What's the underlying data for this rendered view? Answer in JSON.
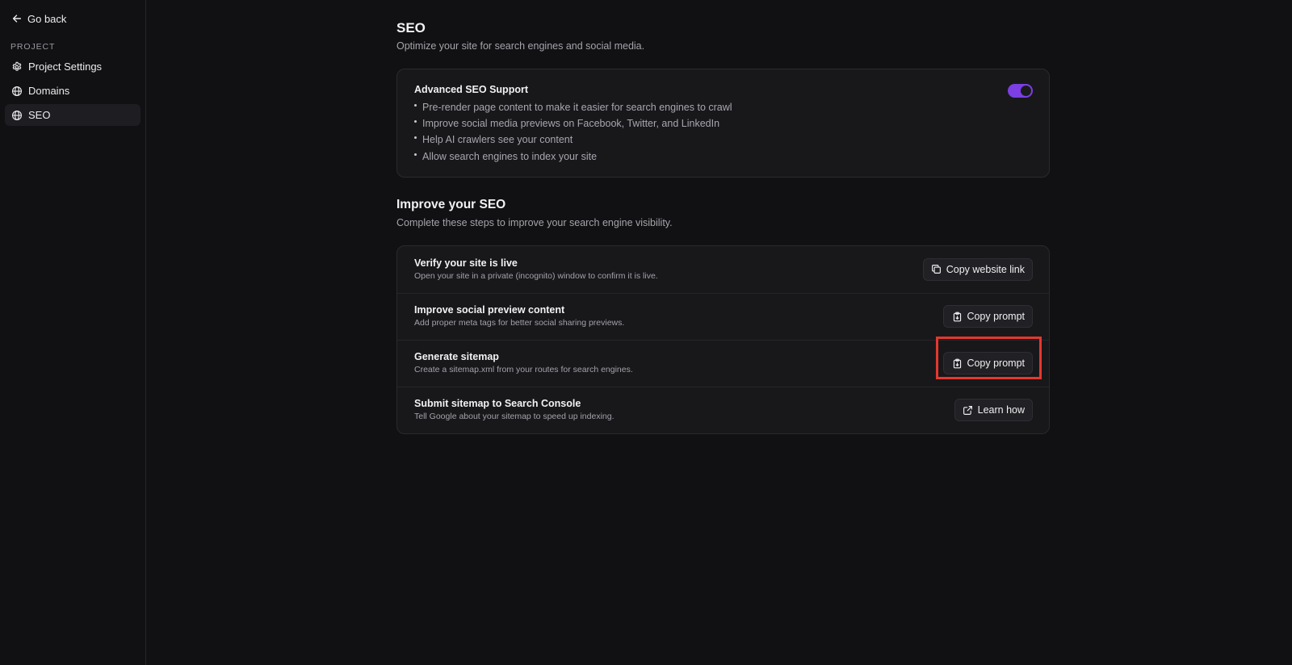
{
  "sidebar": {
    "go_back": "Go back",
    "section_label": "PROJECT",
    "items": [
      {
        "label": "Project Settings",
        "icon": "gear-icon"
      },
      {
        "label": "Domains",
        "icon": "globe-icon"
      },
      {
        "label": "SEO",
        "icon": "globe-icon",
        "active": true
      }
    ]
  },
  "header": {
    "title": "SEO",
    "subtitle": "Optimize your site for search engines and social media."
  },
  "advanced_seo": {
    "title": "Advanced SEO Support",
    "enabled": true,
    "bullets": [
      "Pre-render page content to make it easier for search engines to crawl",
      "Improve social media previews on Facebook, Twitter, and LinkedIn",
      "Help AI crawlers see your content",
      "Allow search engines to index your site"
    ]
  },
  "improve": {
    "title": "Improve your SEO",
    "subtitle": "Complete these steps to improve your search engine visibility.",
    "steps": [
      {
        "title": "Verify your site is live",
        "description": "Open your site in a private (incognito) window to confirm it is live.",
        "button": "Copy website link",
        "icon": "copy-icon"
      },
      {
        "title": "Improve social preview content",
        "description": "Add proper meta tags for better social sharing previews.",
        "button": "Copy prompt",
        "icon": "clipboard-icon"
      },
      {
        "title": "Generate sitemap",
        "description": "Create a sitemap.xml from your routes for search engines.",
        "button": "Copy prompt",
        "icon": "clipboard-icon"
      },
      {
        "title": "Submit sitemap to Search Console",
        "description": "Tell Google about your sitemap to speed up indexing.",
        "button": "Learn how",
        "icon": "external-link-icon"
      }
    ]
  },
  "colors": {
    "background": "#111113",
    "card": "#18181b",
    "accent": "#7b3fe4",
    "highlight": "#e3382f"
  }
}
